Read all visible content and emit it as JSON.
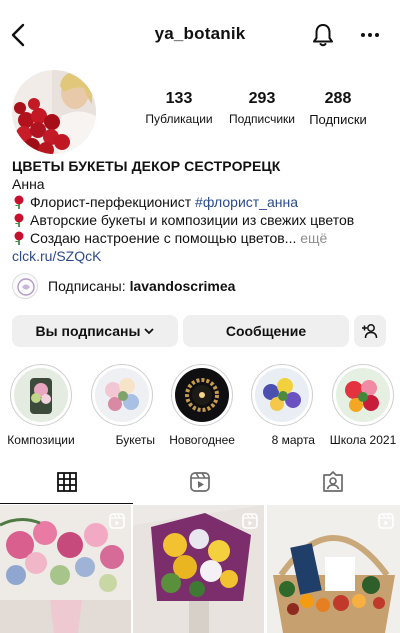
{
  "header": {
    "username": "ya_botanik"
  },
  "icons": {
    "back": "chevron-left-icon",
    "notifications": "bell-icon",
    "more": "more-horizontal-icon"
  },
  "stats": {
    "posts": {
      "count": "133",
      "label": "Публикации"
    },
    "followers": {
      "count": "293",
      "label": "Подписчики"
    },
    "following": {
      "count": "288",
      "label": "Подписки"
    }
  },
  "bio": {
    "title": "ЦВЕТЫ БУКЕТЫ ДЕКОР СЕСТРОРЕЦК",
    "name": "Анна",
    "line1": "Флорист-перфекционист ",
    "hashtag": "#флорист_анна",
    "line2": "Авторские букеты и композиции из свежих цветов",
    "line3": "Создаю настроение с помощью цветов... ",
    "more": "ещё",
    "link": "clck.ru/SZQcK"
  },
  "followed_by": {
    "prefix": "Подписаны:",
    "account": "lavandoscrimea"
  },
  "buttons": {
    "following": "Вы подписаны",
    "message": "Сообщение"
  },
  "highlights": [
    {
      "label": "Композиции"
    },
    {
      "label": "Букеты"
    },
    {
      "label": "Новогоднее"
    },
    {
      "label": "8 марта"
    },
    {
      "label": "Школа 2021"
    }
  ],
  "tabs": [
    "grid-icon",
    "reels-icon",
    "tagged-icon"
  ],
  "colors": {
    "link": "#2c4a8a",
    "button_bg": "#efefef",
    "muted": "#8e8e8e"
  }
}
